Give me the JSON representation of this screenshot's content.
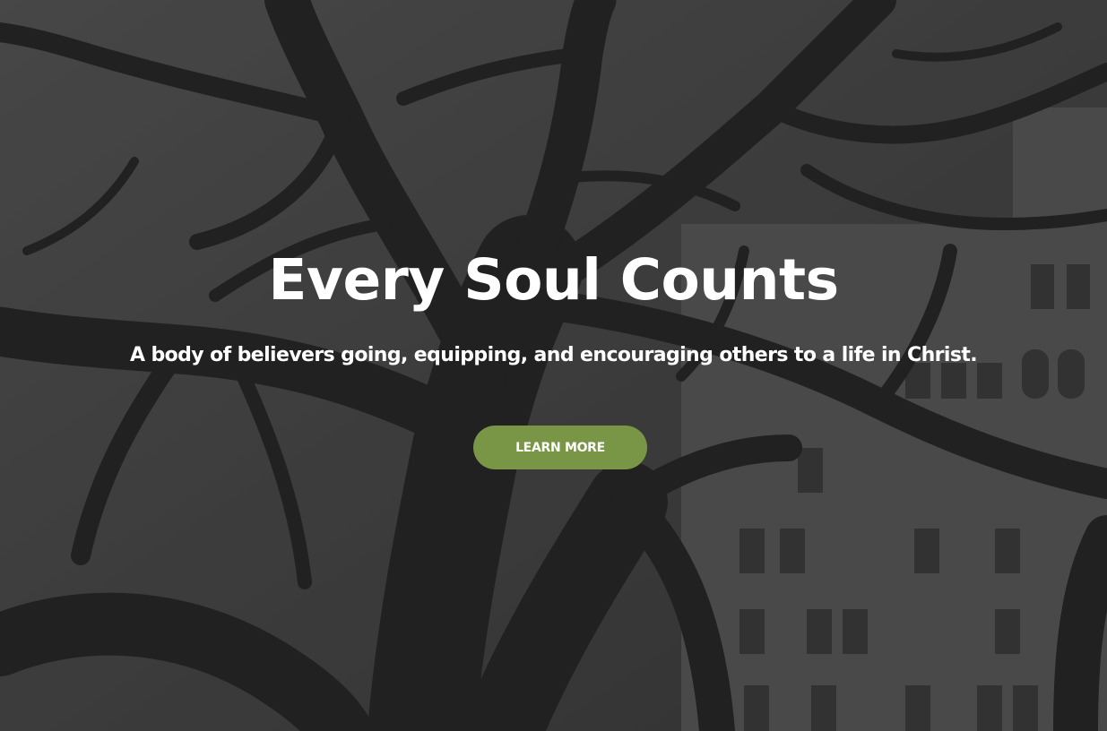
{
  "hero": {
    "title": "Every Soul Counts",
    "subtitle": "A body of believers going, equipping, and encouraging others to a life in Christ.",
    "cta_label": "LEARN MORE",
    "background": "grayscale-oak-tree-photo"
  },
  "colors": {
    "cta_background": "#789645",
    "text": "#ffffff",
    "overlay": "#141414"
  }
}
